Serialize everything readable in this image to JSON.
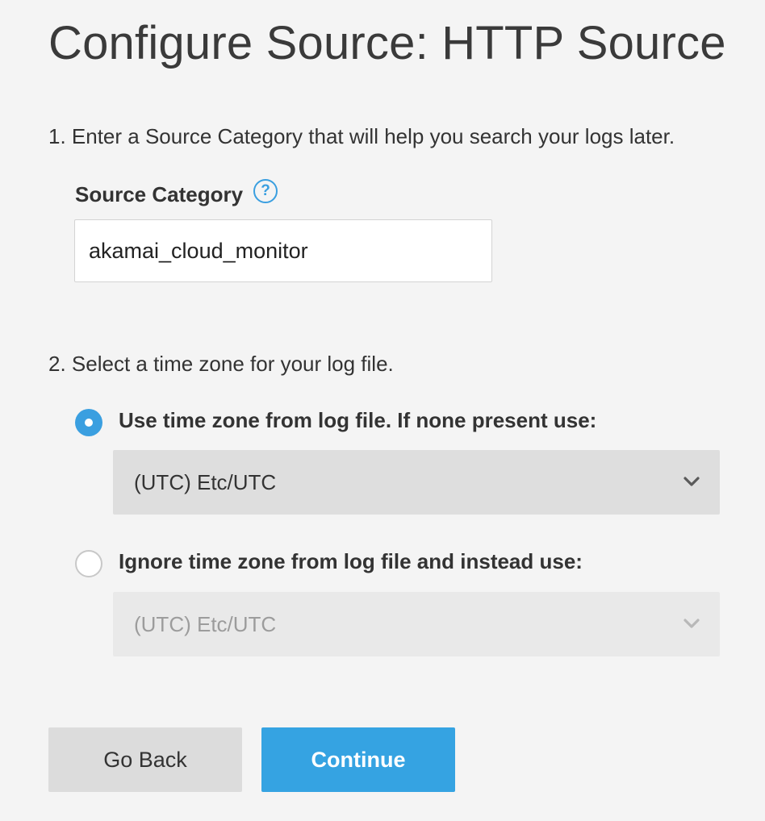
{
  "page_title": "Configure Source: HTTP Source",
  "step1": {
    "instruction": "1. Enter a Source Category that will help you search your logs later.",
    "field_label": "Source Category",
    "help_icon": "question-circle-icon",
    "help_glyph": "?",
    "input_value": "akamai_cloud_monitor"
  },
  "step2": {
    "instruction": "2. Select a time zone for your log file.",
    "options": [
      {
        "label": "Use time zone from log file. If none present use:",
        "selected": true,
        "select_value": "(UTC) Etc/UTC",
        "select_enabled": true
      },
      {
        "label": "Ignore time zone from log file and instead use:",
        "selected": false,
        "select_value": "(UTC) Etc/UTC",
        "select_enabled": false
      }
    ],
    "chevron_icon": "chevron-down-icon"
  },
  "buttons": {
    "back_label": "Go Back",
    "continue_label": "Continue"
  },
  "colors": {
    "accent": "#35a3e2",
    "background": "#f4f4f4",
    "button_secondary": "#dcdcdc",
    "select_enabled": "#dedede",
    "select_disabled": "#e9e9e9"
  }
}
